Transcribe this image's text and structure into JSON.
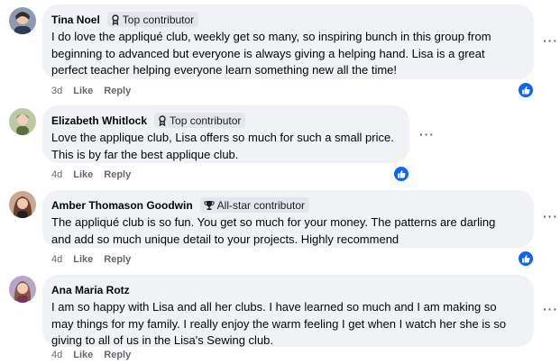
{
  "comments": [
    {
      "name": "Tina Noel",
      "badge": "Top contributor",
      "badge_icon": "contributor-icon",
      "lines": [
        "I do love the appliqué club, weekly get so many, so inspiring bunch in this group from",
        "beginning to advanced but everyone is always giving a helping hand. Lisa is a great",
        "perfect teacher helping everyone learn something new all the time!"
      ],
      "time": "3d",
      "like_label": "Like",
      "reply_label": "Reply",
      "reaction": "like-reaction-icon",
      "more": "···"
    },
    {
      "name": "Elizabeth Whitlock",
      "badge": "Top contributor",
      "badge_icon": "contributor-icon",
      "lines": [
        "Love the applique club, Lisa offers so much for such a small price.",
        "This is by far the best applique club."
      ],
      "time": "4d",
      "like_label": "Like",
      "reply_label": "Reply",
      "reaction": "like-reaction-icon",
      "more": "···"
    },
    {
      "name": "Amber Thomason Goodwin",
      "badge": "All-star contributor",
      "badge_icon": "trophy-icon",
      "lines": [
        "The appliqué club is so fun. You get so much for your money. The patterns are darling",
        "and add so much unique detail to your projects. Highly recommend"
      ],
      "time": "4d",
      "like_label": "Like",
      "reply_label": "Reply",
      "reaction": "like-reaction-icon",
      "more": "···"
    },
    {
      "name": "Ana Maria Rotz",
      "badge": "",
      "lines": [
        "I am so happy with Lisa and all her clubs. I have learned so much and I am making so",
        "may things for my family. I really enjoy the warm feeling I get when I watch her she is so",
        "giving to all of us in the Lisa's Sewing club."
      ],
      "time": "4d",
      "like_label": "Like",
      "reply_label": "Reply",
      "more": "···"
    }
  ],
  "colors": {
    "bubble": "#f0f2f5",
    "badge_bg": "#e4e6eb",
    "like_blue": "#0866ff",
    "meta_gray": "#65676b"
  }
}
